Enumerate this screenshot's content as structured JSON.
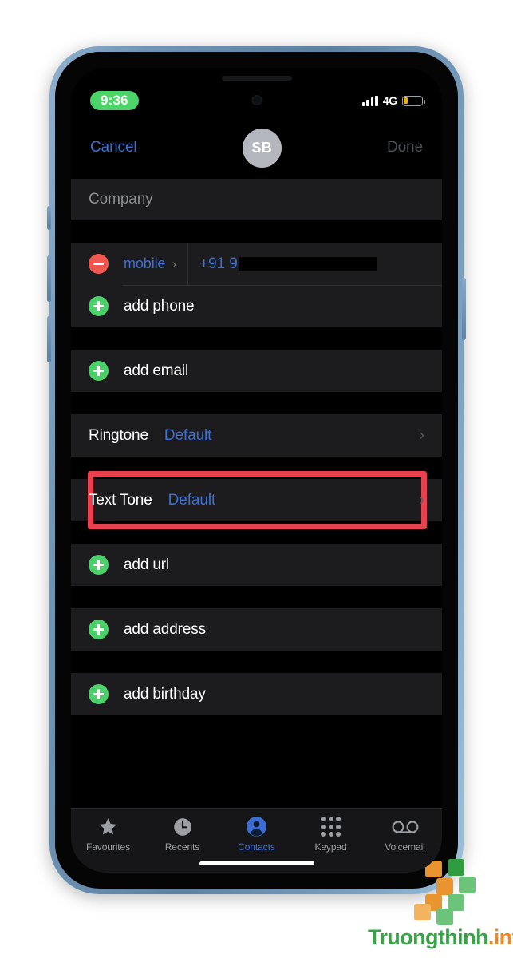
{
  "status_bar": {
    "time": "9:36",
    "network": "4G",
    "signal_icon": "signal-bars-icon",
    "battery_icon": "battery-low-icon",
    "battery_level_percent": 24,
    "time_pill_color": "#4cd469",
    "battery_fill_color": "#e5b020"
  },
  "nav_bar": {
    "cancel_label": "Cancel",
    "done_label": "Done",
    "avatar_initials": "SB"
  },
  "theme": {
    "accent_blue": "#3c6fd6",
    "add_green": "#4cd06a",
    "delete_red": "#f0584f",
    "highlight_red": "#e8404f",
    "screen_bg": "#000000",
    "row_bg": "#1c1c1e"
  },
  "form": {
    "company_placeholder": "Company",
    "phone": {
      "type_label": "mobile",
      "type_chevron": "chevron-right-icon",
      "value_prefix": "+91 9",
      "redacted": true,
      "delete_icon": "minus-circle-icon"
    },
    "add_phone_label": "add phone",
    "add_email_label": "add email",
    "ringtone": {
      "label": "Ringtone",
      "value": "Default",
      "chevron": "chevron-right-icon"
    },
    "text_tone": {
      "label": "Text Tone",
      "value": "Default",
      "chevron": "chevron-right-icon",
      "highlighted": true
    },
    "add_url_label": "add url",
    "add_address_label": "add address",
    "add_birthday_label": "add birthday",
    "add_icon": "plus-circle-icon"
  },
  "tab_bar": {
    "tabs": [
      {
        "label": "Favourites",
        "icon": "star-icon",
        "active": false
      },
      {
        "label": "Recents",
        "icon": "clock-icon",
        "active": false
      },
      {
        "label": "Contacts",
        "icon": "person-circle-icon",
        "active": true
      },
      {
        "label": "Keypad",
        "icon": "keypad-grid-icon",
        "active": false
      },
      {
        "label": "Voicemail",
        "icon": "voicemail-icon",
        "active": false
      }
    ]
  },
  "watermark": {
    "brand": "Truongthinh",
    "domain": ".info",
    "brand_color": "#36a347",
    "domain_color": "#ef8822"
  }
}
